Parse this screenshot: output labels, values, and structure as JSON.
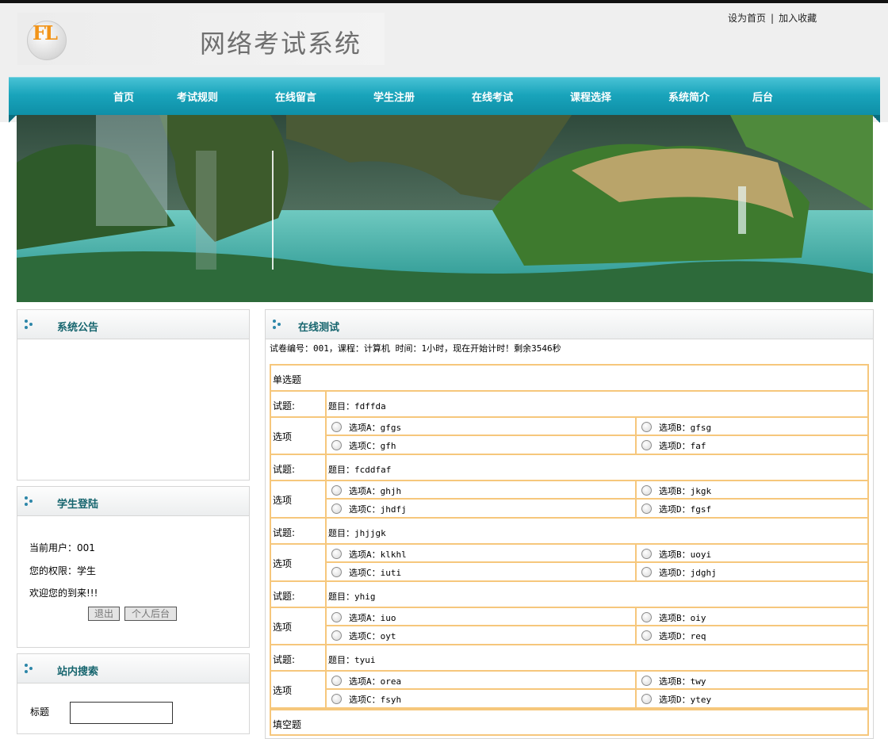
{
  "header": {
    "logo_text": "FL",
    "site_title": "网络考试系统",
    "links": [
      "设为首页",
      "加入收藏"
    ],
    "link_separator": "|"
  },
  "nav": [
    "首页",
    "考试规则",
    "在线留言",
    "学生注册",
    "在线考试",
    "课程选择",
    "系统简介",
    "后台"
  ],
  "sidebar": {
    "announcement_title": "系统公告",
    "login": {
      "title": "学生登陆",
      "current_user": "当前用户：001",
      "permission": "您的权限：学生",
      "welcome": "欢迎您的到来!!!",
      "logout_button": "退出",
      "backend_button": "个人后台"
    },
    "search": {
      "title": "站内搜索",
      "label": "标题"
    }
  },
  "main": {
    "panel_title": "在线测试",
    "exam_info": "试卷编号：001，课程：计算机 时间：1小时，现在开始计时！剩余3546秒",
    "section_single": "单选题",
    "section_fill": "填空题",
    "question_label": "试题:",
    "option_label": "选项",
    "questions": [
      {
        "text": "题目：fdffda",
        "options": [
          "选项A：gfgs",
          "选项B：gfsg",
          "选项C：gfh",
          "选项D：faf"
        ]
      },
      {
        "text": "题目：fcddfaf",
        "options": [
          "选项A：ghjh",
          "选项B：jkgk",
          "选项C：jhdfj",
          "选项D：fgsf"
        ]
      },
      {
        "text": "题目：jhjjgk",
        "options": [
          "选项A：klkhl",
          "选项B：uoyi",
          "选项C：iuti",
          "选项D：jdghj"
        ]
      },
      {
        "text": "题目：yhig",
        "options": [
          "选项A：iuo",
          "选项B：oiy",
          "选项C：oyt",
          "选项D：req"
        ]
      },
      {
        "text": "题目：tyui",
        "options": [
          "选项A：orea",
          "选项B：twy",
          "选项C：fsyh",
          "选项D：ytey"
        ]
      }
    ]
  },
  "colors": {
    "nav_bg": "#19a4bb",
    "table_border": "#f6c77c",
    "panel_title": "#16656e",
    "logo_accent": "#f29418"
  }
}
